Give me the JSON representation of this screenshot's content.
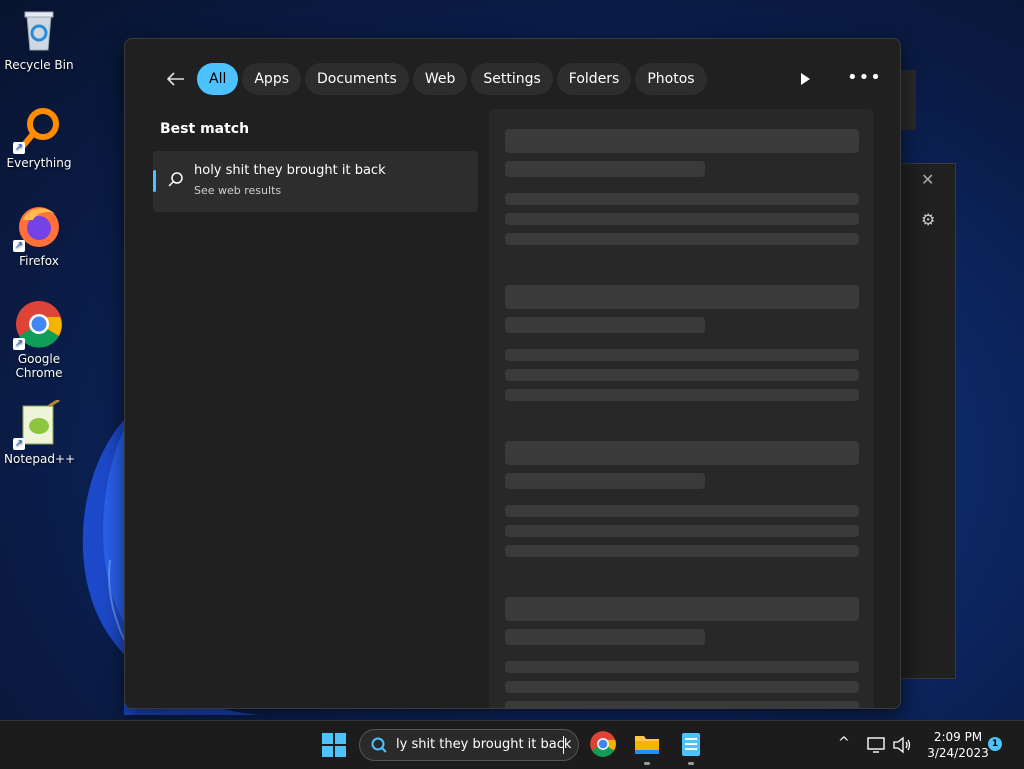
{
  "desktop": {
    "icons": [
      {
        "label": "Recycle Bin",
        "icon": "recycle-bin-icon"
      },
      {
        "label": "Everything",
        "icon": "everything-icon"
      },
      {
        "label": "Firefox",
        "icon": "firefox-icon"
      },
      {
        "label": "Google Chrome",
        "icon": "chrome-icon"
      },
      {
        "label": "Notepad++",
        "icon": "notepadpp-icon"
      }
    ]
  },
  "search_panel": {
    "filters": [
      "All",
      "Apps",
      "Documents",
      "Web",
      "Settings",
      "Folders",
      "Photos"
    ],
    "active_filter": "All",
    "best_match_heading": "Best match",
    "best_match": {
      "title": "holy shit they brought it back",
      "subtitle": "See web results"
    }
  },
  "taskbar": {
    "search_text": "ly shit they brought it back",
    "clock_time": "2:09 PM",
    "clock_date": "3/24/2023",
    "notification_count": "1"
  },
  "colors": {
    "accent": "#4cc2ff",
    "panel_bg": "#202020",
    "taskbar_bg": "#1c1c1c"
  }
}
